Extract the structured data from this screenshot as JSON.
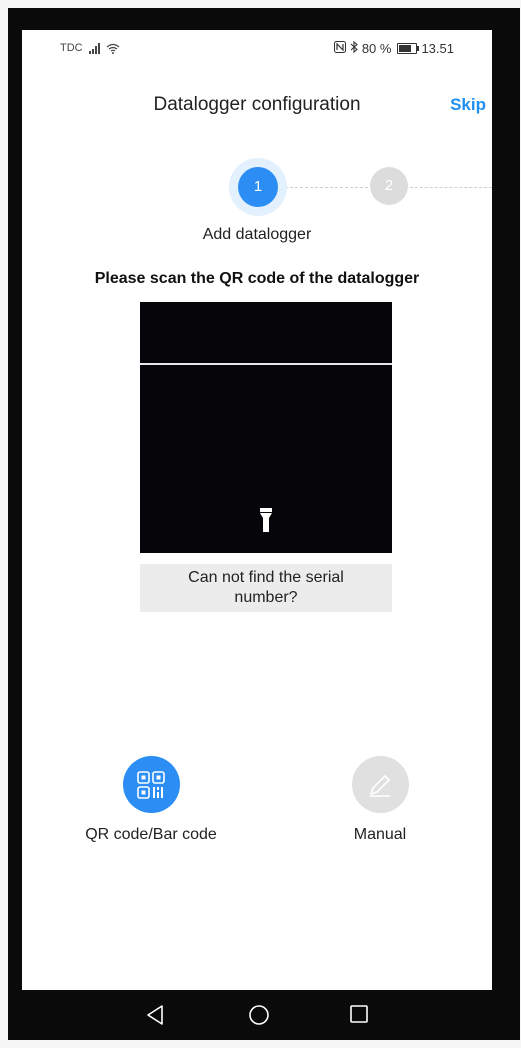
{
  "status_bar": {
    "carrier": "TDC",
    "battery_percent": "80 %",
    "time": "13.51",
    "icons": [
      "signal-icon",
      "wifi-icon",
      "nfc-icon",
      "bluetooth-icon",
      "battery-icon"
    ]
  },
  "header": {
    "title": "Datalogger configuration",
    "skip_label": "Skip"
  },
  "stepper": {
    "steps": [
      {
        "number": "1",
        "label": "Add datalogger",
        "active": true
      },
      {
        "number": "2",
        "active": false
      }
    ]
  },
  "scan": {
    "instruction": "Please scan the QR code of the datalogger",
    "help_text": "Can not find the serial number?",
    "flash_icon": "flashlight-icon"
  },
  "modes": {
    "qr_label": "QR code/Bar code",
    "manual_label": "Manual",
    "selected": "QR code/Bar code"
  },
  "nav": {
    "icons": [
      "back-icon",
      "home-icon",
      "recent-apps-icon"
    ]
  },
  "colors": {
    "accent": "#2c8ef4",
    "skip": "#1f8ff0",
    "inactive": "#dcdcdc",
    "camera": "#05050a"
  }
}
